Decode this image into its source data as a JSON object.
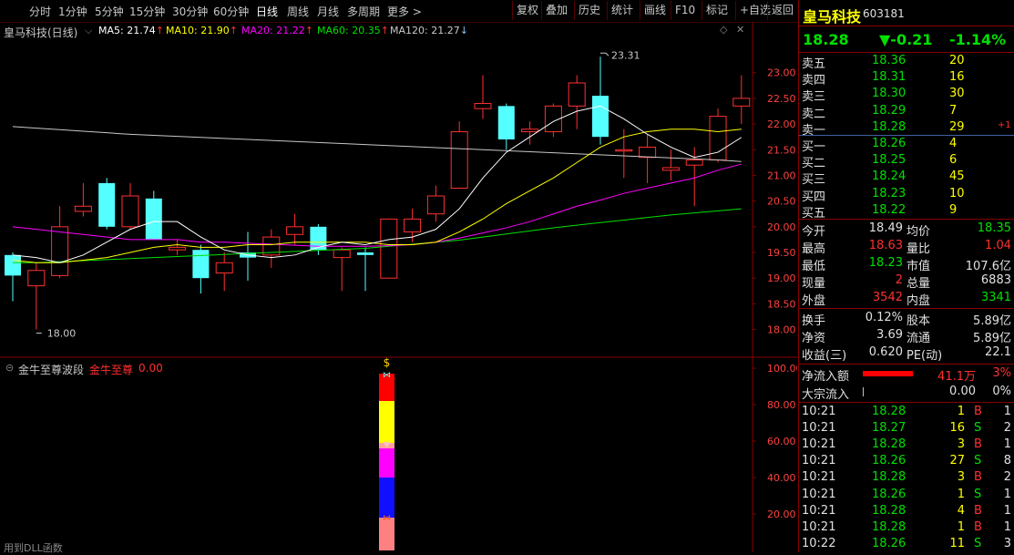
{
  "toolbar": {
    "periods": [
      "分时",
      "1分钟",
      "5分钟",
      "15分钟",
      "30分钟",
      "60分钟",
      "日线",
      "周线",
      "月线",
      "多周期",
      "更多 >"
    ],
    "selected_period": "日线",
    "buttons": [
      "复权",
      "叠加",
      "历史",
      "统计",
      "画线",
      "F10",
      "标记",
      "+自选",
      "返回"
    ]
  },
  "main_chart": {
    "stock_label": "皇马科技(日线)",
    "ma": [
      {
        "name": "MA5",
        "value": "21.74",
        "arrow": "↑",
        "color": "#ffffff"
      },
      {
        "name": "MA10",
        "value": "21.90",
        "arrow": "↑",
        "color": "#ffff00"
      },
      {
        "name": "MA20",
        "value": "21.22",
        "arrow": "↑",
        "color": "#ff00ff"
      },
      {
        "name": "MA60",
        "value": "20.35",
        "arrow": "↑",
        "color": "#00e000"
      },
      {
        "name": "MA120",
        "value": "21.27",
        "arrow": "↓",
        "color": "#c8c8c8"
      }
    ],
    "high_label": "23.31",
    "low_label": "18.00",
    "y_ticks": [
      "23.00",
      "22.50",
      "22.00",
      "21.50",
      "21.00",
      "20.50",
      "20.00",
      "19.50",
      "19.00",
      "18.50",
      "18.00"
    ]
  },
  "chart_data": {
    "type": "candlestick",
    "ylim": [
      17.85,
      23.35
    ],
    "candles": [
      {
        "o": 19.45,
        "c": 19.05,
        "h": 19.5,
        "l": 18.55
      },
      {
        "o": 18.85,
        "c": 19.15,
        "h": 19.3,
        "l": 18.0
      },
      {
        "o": 19.05,
        "c": 20.0,
        "h": 20.4,
        "l": 19.0
      },
      {
        "o": 20.3,
        "c": 20.4,
        "h": 20.85,
        "l": 20.2
      },
      {
        "o": 20.85,
        "c": 20.0,
        "h": 20.95,
        "l": 19.95
      },
      {
        "o": 20.0,
        "c": 20.6,
        "h": 20.85,
        "l": 19.95
      },
      {
        "o": 20.55,
        "c": 19.75,
        "h": 20.7,
        "l": 19.75
      },
      {
        "o": 19.55,
        "c": 19.6,
        "h": 19.75,
        "l": 19.45
      },
      {
        "o": 19.55,
        "c": 19.0,
        "h": 19.65,
        "l": 18.7
      },
      {
        "o": 19.1,
        "c": 19.3,
        "h": 19.5,
        "l": 18.75
      },
      {
        "o": 19.5,
        "c": 19.4,
        "h": 19.9,
        "l": 18.95
      },
      {
        "o": 19.45,
        "c": 19.8,
        "h": 19.95,
        "l": 19.2
      },
      {
        "o": 19.85,
        "c": 20.0,
        "h": 20.25,
        "l": 19.65
      },
      {
        "o": 20.0,
        "c": 19.55,
        "h": 20.05,
        "l": 19.45
      },
      {
        "o": 19.4,
        "c": 19.55,
        "h": 19.6,
        "l": 18.75
      },
      {
        "o": 19.5,
        "c": 19.45,
        "h": 19.6,
        "l": 18.75
      },
      {
        "o": 19.0,
        "c": 20.15,
        "h": 20.15,
        "l": 19.0
      },
      {
        "o": 19.9,
        "c": 20.15,
        "h": 20.35,
        "l": 19.7
      },
      {
        "o": 20.25,
        "c": 20.6,
        "h": 20.8,
        "l": 20.1
      },
      {
        "o": 20.75,
        "c": 21.85,
        "h": 22.05,
        "l": 20.75
      },
      {
        "o": 22.3,
        "c": 22.4,
        "h": 22.95,
        "l": 22.1
      },
      {
        "o": 22.35,
        "c": 21.7,
        "h": 22.4,
        "l": 21.5
      },
      {
        "o": 21.85,
        "c": 21.9,
        "h": 22.05,
        "l": 21.6
      },
      {
        "o": 21.85,
        "c": 22.35,
        "h": 22.4,
        "l": 21.75
      },
      {
        "o": 22.35,
        "c": 22.8,
        "h": 22.95,
        "l": 21.9
      },
      {
        "o": 22.55,
        "c": 21.75,
        "h": 23.31,
        "l": 21.6
      },
      {
        "o": 21.5,
        "c": 21.5,
        "h": 21.9,
        "l": 20.95
      },
      {
        "o": 21.35,
        "c": 21.55,
        "h": 21.8,
        "l": 20.85
      },
      {
        "o": 21.1,
        "c": 21.15,
        "h": 21.5,
        "l": 20.9
      },
      {
        "o": 21.2,
        "c": 21.3,
        "h": 21.55,
        "l": 20.4
      },
      {
        "o": 21.3,
        "c": 22.15,
        "h": 22.3,
        "l": 21.25
      },
      {
        "o": 22.35,
        "c": 22.5,
        "h": 22.95,
        "l": 22.0
      }
    ],
    "ma5": [
      19.45,
      19.4,
      19.3,
      19.45,
      19.7,
      19.95,
      20.1,
      20.1,
      19.8,
      19.55,
      19.45,
      19.4,
      19.45,
      19.6,
      19.7,
      19.65,
      19.75,
      19.8,
      19.95,
      20.35,
      20.95,
      21.45,
      21.75,
      22.05,
      22.25,
      22.35,
      22.1,
      21.8,
      21.55,
      21.35,
      21.45,
      21.74
    ],
    "ma10": [
      19.35,
      19.3,
      19.3,
      19.35,
      19.4,
      19.5,
      19.6,
      19.65,
      19.6,
      19.6,
      19.65,
      19.65,
      19.7,
      19.7,
      19.7,
      19.7,
      19.65,
      19.65,
      19.7,
      19.9,
      20.15,
      20.45,
      20.7,
      20.95,
      21.25,
      21.55,
      21.75,
      21.85,
      21.9,
      21.9,
      21.85,
      21.9
    ],
    "ma20": [
      20.0,
      19.95,
      19.9,
      19.85,
      19.8,
      19.75,
      19.75,
      19.75,
      19.7,
      19.7,
      19.68,
      19.66,
      19.64,
      19.62,
      19.62,
      19.62,
      19.63,
      19.65,
      19.7,
      19.78,
      19.88,
      19.98,
      20.1,
      20.25,
      20.4,
      20.52,
      20.65,
      20.75,
      20.85,
      20.95,
      21.1,
      21.22
    ],
    "ma60": [
      19.3,
      19.3,
      19.32,
      19.34,
      19.36,
      19.38,
      19.4,
      19.42,
      19.44,
      19.46,
      19.48,
      19.5,
      19.52,
      19.54,
      19.56,
      19.58,
      19.62,
      19.66,
      19.7,
      19.74,
      19.8,
      19.86,
      19.92,
      19.98,
      20.03,
      20.08,
      20.13,
      20.18,
      20.23,
      20.27,
      20.31,
      20.35
    ],
    "ma120": [
      21.95,
      21.92,
      21.89,
      21.86,
      21.83,
      21.8,
      21.78,
      21.76,
      21.74,
      21.72,
      21.7,
      21.68,
      21.66,
      21.64,
      21.62,
      21.6,
      21.58,
      21.56,
      21.54,
      21.52,
      21.5,
      21.48,
      21.46,
      21.44,
      21.42,
      21.4,
      21.38,
      21.36,
      21.34,
      21.32,
      21.3,
      21.27
    ]
  },
  "sub_chart": {
    "title": "金牛至尊波段",
    "legend_name": "金牛至尊",
    "legend_value": "0.00",
    "y_ticks": [
      "100.00",
      "80.00",
      "60.00",
      "40.00",
      "20.00"
    ],
    "footer": "用到DLL函数",
    "bar_segments": [
      {
        "from": 0,
        "to": 18,
        "color": "#ff8080"
      },
      {
        "from": 18,
        "to": 40,
        "color": "#1010ff"
      },
      {
        "from": 40,
        "to": 56,
        "color": "#ff00ff"
      },
      {
        "from": 56,
        "to": 59,
        "color": "#ffa0a0"
      },
      {
        "from": 59,
        "to": 82,
        "color": "#ffff00"
      },
      {
        "from": 82,
        "to": 97,
        "color": "#ff0000"
      }
    ]
  },
  "quote": {
    "name": "皇马科技",
    "code": "603181",
    "price": "18.28",
    "change": "▼-0.21",
    "pct": "-1.14%",
    "sells": [
      {
        "label": "卖五",
        "price": "18.36",
        "vol": "20",
        "extra": ""
      },
      {
        "label": "卖四",
        "price": "18.31",
        "vol": "16",
        "extra": ""
      },
      {
        "label": "卖三",
        "price": "18.30",
        "vol": "30",
        "extra": ""
      },
      {
        "label": "卖二",
        "price": "18.29",
        "vol": "7",
        "extra": ""
      },
      {
        "label": "卖一",
        "price": "18.28",
        "vol": "29",
        "extra": "+1"
      }
    ],
    "buys": [
      {
        "label": "买一",
        "price": "18.26",
        "vol": "4"
      },
      {
        "label": "买二",
        "price": "18.25",
        "vol": "6"
      },
      {
        "label": "买三",
        "price": "18.24",
        "vol": "45"
      },
      {
        "label": "买四",
        "price": "18.23",
        "vol": "10"
      },
      {
        "label": "买五",
        "price": "18.22",
        "vol": "9"
      }
    ],
    "stats": [
      {
        "l1": "今开",
        "v1": "18.49",
        "c1": "w",
        "l2": "均价",
        "v2": "18.35",
        "c2": "g"
      },
      {
        "l1": "最高",
        "v1": "18.63",
        "c1": "r",
        "l2": "量比",
        "v2": "1.04",
        "c2": "r"
      },
      {
        "l1": "最低",
        "v1": "18.23",
        "c1": "g",
        "l2": "市值",
        "v2": "107.6亿",
        "c2": "w"
      },
      {
        "l1": "现量",
        "v1": "2",
        "c1": "r",
        "l2": "总量",
        "v2": "6883",
        "c2": "w"
      },
      {
        "l1": "外盘",
        "v1": "3542",
        "c1": "r",
        "l2": "内盘",
        "v2": "3341",
        "c2": "g"
      }
    ],
    "stats2": [
      {
        "l1": "换手",
        "v1": "0.12%",
        "l2": "股本",
        "v2": "5.89亿"
      },
      {
        "l1": "净资",
        "v1": "3.69",
        "l2": "流通",
        "v2": "5.89亿"
      },
      {
        "l1": "收益(三)",
        "v1": "0.620",
        "l2": "PE(动)",
        "v2": "22.1"
      }
    ],
    "flow": [
      {
        "label": "净流入额",
        "value": "41.1万",
        "pct": "3%"
      },
      {
        "label": "大宗流入",
        "value": "0.00",
        "pct": "0%"
      }
    ],
    "ticks": [
      {
        "t": "10:21",
        "p": "18.28",
        "v": "1",
        "bs": "B",
        "n": "1"
      },
      {
        "t": "10:21",
        "p": "18.27",
        "v": "16",
        "bs": "S",
        "n": "2"
      },
      {
        "t": "10:21",
        "p": "18.28",
        "v": "3",
        "bs": "B",
        "n": "1"
      },
      {
        "t": "10:21",
        "p": "18.26",
        "v": "27",
        "bs": "S",
        "n": "8"
      },
      {
        "t": "10:21",
        "p": "18.28",
        "v": "3",
        "bs": "B",
        "n": "2"
      },
      {
        "t": "10:21",
        "p": "18.26",
        "v": "1",
        "bs": "S",
        "n": "1"
      },
      {
        "t": "10:21",
        "p": "18.28",
        "v": "4",
        "bs": "B",
        "n": "1"
      },
      {
        "t": "10:21",
        "p": "18.28",
        "v": "1",
        "bs": "B",
        "n": "1"
      },
      {
        "t": "10:22",
        "p": "18.26",
        "v": "11",
        "bs": "S",
        "n": "3"
      }
    ]
  }
}
